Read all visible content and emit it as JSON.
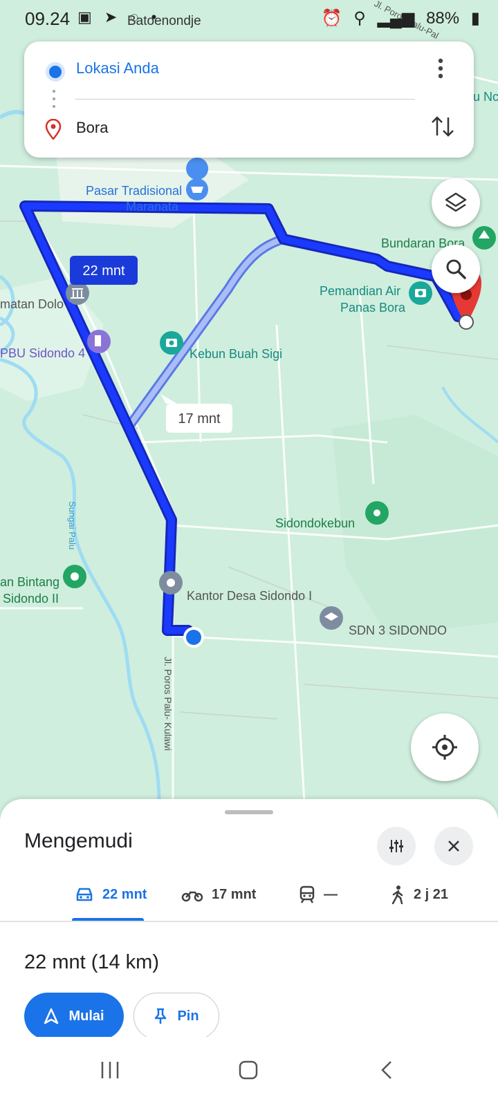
{
  "status_bar": {
    "time": "09.24",
    "battery": "88%"
  },
  "search": {
    "origin": "Lokasi Anda",
    "destination": "Bora"
  },
  "map": {
    "labels": {
      "pasar_line1": "Pasar Tradisional",
      "pasar_line2": "Maranata",
      "bundaran": "Bundaran Bora",
      "pemandian_line1": "Pemandian Air",
      "pemandian_line2": "Panas Bora",
      "kecamatan": "matan Dolo",
      "spbu": "PBU Sidondo 4",
      "kebun": "Kebun Buah Sigi",
      "sungai": "Sungai Palu",
      "sidondokebun": "Sidondokebun",
      "bintang_line1": "an Bintang",
      "bintang_line2": "Sidondo II",
      "kantor": "Kantor Desa Sidondo I",
      "sdn": "SDN 3 SIDONDO",
      "road_main": "Jl. Poros Palu- Kulawi",
      "road_top": "Jl. Poros Palu-Pal",
      "batoenondje": "Batoenondje",
      "top_right": "u Nc"
    },
    "route_labels": {
      "primary": "22 mnt",
      "alternative": "17 mnt"
    },
    "colors": {
      "primary_route": "#1a3bff",
      "alt_route": "#8fa8f5",
      "water": "#8fd4f0",
      "land": "#cfeedd"
    }
  },
  "sheet": {
    "title": "Mengemudi",
    "modes": [
      {
        "icon": "car-icon",
        "label": "22 mnt",
        "active": true
      },
      {
        "icon": "motorcycle-icon",
        "label": "17 mnt",
        "active": false
      },
      {
        "icon": "train-icon",
        "label": "—",
        "active": false
      },
      {
        "icon": "walk-icon",
        "label": "2 j 21",
        "active": false
      }
    ],
    "summary": "22 mnt (14 km)",
    "start_label": "Mulai",
    "pin_label": "Pin"
  }
}
